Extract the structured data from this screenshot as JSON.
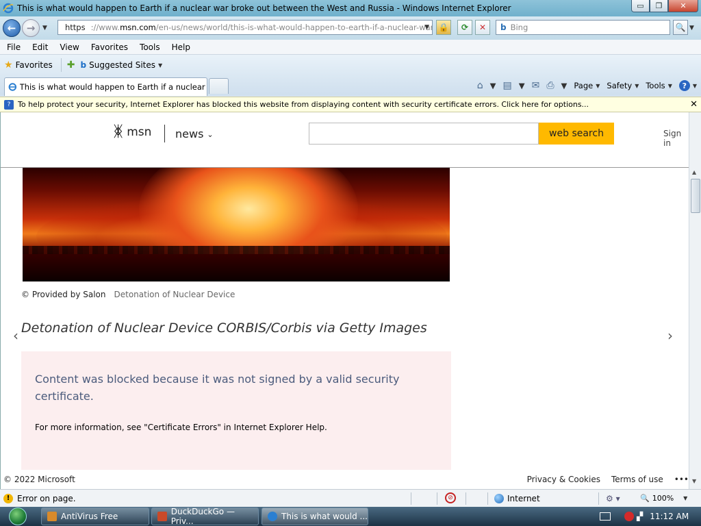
{
  "window": {
    "title": "This is what would happen to Earth if a nuclear war broke out between the West and Russia - Windows Internet Explorer",
    "min_label": "▭",
    "max_label": "❐",
    "close_label": "✕"
  },
  "address_bar": {
    "scheme": "https",
    "www": "://www.",
    "host": "msn.com",
    "path": "/en-us/news/world/this-is-what-would-happen-to-earth-if-a-nuclear-war-bre",
    "search_placeholder": "Bing"
  },
  "menu": [
    "File",
    "Edit",
    "View",
    "Favorites",
    "Tools",
    "Help"
  ],
  "favorites_bar": {
    "favorites_label": "Favorites",
    "suggested_label": "Suggested Sites"
  },
  "tabs": {
    "active_title": "This is what would happen to Earth if a nuclear wa..."
  },
  "command_bar": {
    "page_label": "Page",
    "safety_label": "Safety",
    "tools_label": "Tools"
  },
  "info_bar": {
    "text": "To help protect your security, Internet Explorer has blocked this website from displaying content with security certificate errors. Click here for options..."
  },
  "msn": {
    "brand": "msn",
    "section": "news",
    "search_button": "web search",
    "sign_in": "Sign in"
  },
  "article": {
    "credit_provider": "© Provided by Salon",
    "credit_caption": "Detonation of Nuclear Device",
    "big_caption": "Detonation of Nuclear Device CORBIS/Corbis via Getty Images",
    "blocked_title": "Content was blocked because it was not signed by a valid security certificate.",
    "blocked_more": "For more information, see \"Certificate Errors\" in Internet Explorer Help."
  },
  "page_footer": {
    "copyright": "© 2022 Microsoft",
    "privacy": "Privacy & Cookies",
    "terms": "Terms of use",
    "more": "•••"
  },
  "status_bar": {
    "status_text": "Error on page.",
    "zone": "Internet",
    "zoom": "100%"
  },
  "taskbar": {
    "items": [
      {
        "label": "AntiVirus Free"
      },
      {
        "label": "DuckDuckGo — Priv..."
      },
      {
        "label": "This is what would ..."
      }
    ],
    "clock": "11:12 AM"
  },
  "colors": {
    "msn_search_button": "#ffb900",
    "blocked_box_bg": "#fceeef",
    "info_bar_bg": "#ffffe1",
    "ie_blue": "#1e5ba8"
  }
}
